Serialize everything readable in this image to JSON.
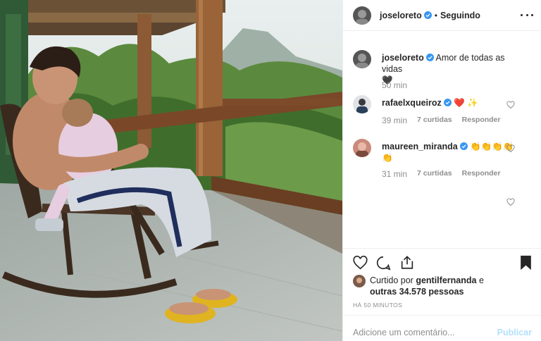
{
  "post": {
    "author": "joseloreto",
    "follow_status": "Seguindo",
    "separator": "•"
  },
  "caption": {
    "username": "joseloreto",
    "text": "Amor de todas as vidas",
    "emoji": "🖤",
    "time": "50 min"
  },
  "comments": [
    {
      "username": "rafaelxqueiroz",
      "emoji": "❤️ ✨",
      "time": "39 min",
      "likes": "7 curtidas",
      "reply": "Responder"
    },
    {
      "username": "maureen_miranda",
      "emoji": "👏👏👏👏 👏",
      "time": "31 min",
      "likes": "7 curtidas",
      "reply": "Responder"
    }
  ],
  "liked_by": {
    "prefix": "Curtido por",
    "user": "gentilfernanda",
    "conj": "e",
    "others": "outras 34.578 pessoas"
  },
  "posted_ago": "HÁ 50 MINUTOS",
  "comment_box": {
    "placeholder": "Adicione um comentário...",
    "publish": "Publicar"
  },
  "colors": {
    "verified": "#3897f0",
    "muted": "#8e8e8e",
    "publish_disabled": "#b2dffc"
  }
}
